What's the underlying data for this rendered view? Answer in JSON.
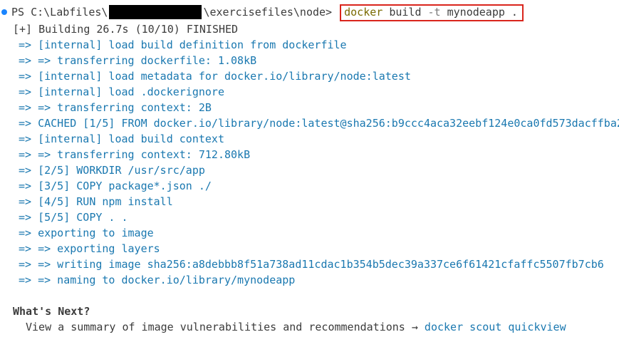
{
  "terminal": {
    "prompt": {
      "prefix": "PS C:\\Labfiles\\",
      "suffix": "\\exercisefiles\\node>",
      "command": {
        "program": "docker",
        "args": "build",
        "flag": "-t",
        "target": "mynodeapp ."
      }
    },
    "status": "[+] Building 26.7s (10/10) FINISHED",
    "steps": [
      "=> [internal] load build definition from dockerfile",
      "=> => transferring dockerfile: 1.08kB",
      "=> [internal] load metadata for docker.io/library/node:latest",
      "=> [internal] load .dockerignore",
      "=> => transferring context: 2B",
      "=> CACHED [1/5] FROM docker.io/library/node:latest@sha256:b9ccc4aca32eebf124e0ca0fd573dacffba2",
      "=> [internal] load build context",
      "=> => transferring context: 712.80kB",
      "=> [2/5] WORKDIR /usr/src/app",
      "=> [3/5] COPY package*.json ./",
      "=> [4/5] RUN npm install",
      "=> [5/5] COPY . .",
      "=> exporting to image",
      "=> => exporting layers",
      "=> => writing image sha256:a8debbb8f51a738ad11cdac1b354b5dec39a337ce6f61421cfaffc5507fb7cb6",
      "=> => naming to docker.io/library/mynodeapp"
    ],
    "next": {
      "title": "What's Next?",
      "text": "View a summary of image vulnerabilities and recommendations →",
      "link": "docker scout quickview"
    }
  },
  "colors": {
    "info": "#1a78b0",
    "highlight_border": "#d9251c",
    "prompt_marker": "#1a85ff"
  }
}
